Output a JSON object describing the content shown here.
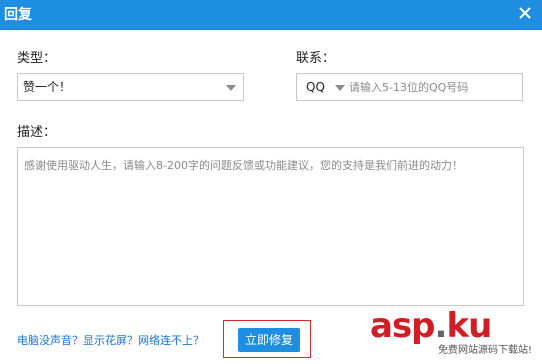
{
  "dialog": {
    "title": "回复",
    "close_icon": "close-icon"
  },
  "form": {
    "type_label": "类型：",
    "type_value": "赞一个！",
    "contact_label": "联系：",
    "contact_type": "QQ",
    "contact_placeholder": "请输入5-13位的QQ号码",
    "contact_value": "",
    "desc_label": "描述：",
    "desc_placeholder": "感谢使用驱动人生，请输入8-200字的问题反馈或功能建议，您的支持是我们前进的动力！",
    "desc_value": ""
  },
  "footer": {
    "links": [
      "电脑没声音？",
      "显示花屏？",
      "网络连不上？"
    ],
    "fix_button": "立即修复"
  },
  "watermark": {
    "asp": "asp",
    "dot": ".",
    "ku": "ku",
    "sub": "免费网站源码下载站!"
  },
  "colors": {
    "accent": "#1e8ee0",
    "link": "#1a73d9",
    "highlight_border": "#d62b2b",
    "watermark_red": "#d11d24"
  }
}
